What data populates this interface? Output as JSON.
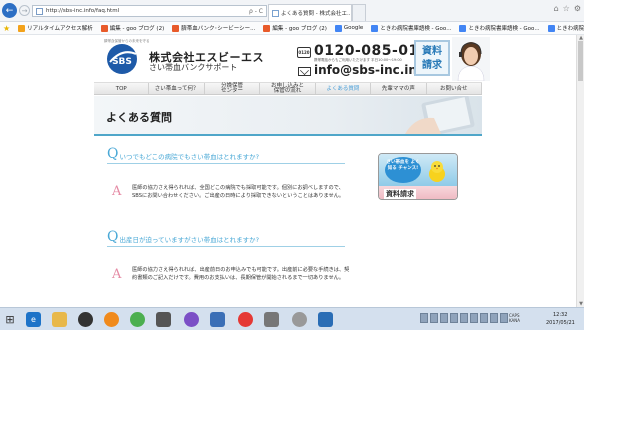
{
  "browser": {
    "url": "http://sbs-inc.info/faq.html",
    "url_tools": "ρ - C",
    "active_tab": "よくある質問 - 株式会社エ...",
    "tab_close": "×",
    "new_tab": "",
    "right_icons": [
      "home-icon",
      "star-icon",
      "gear-icon"
    ]
  },
  "favorites": [
    {
      "label": "リアルタイムアクセス解析",
      "color": "#f3a21b"
    },
    {
      "label": "編集 - goo ブログ (2)",
      "color": "#e85a2a"
    },
    {
      "label": "臍帯血バンク･シービーシー...",
      "color": "#e85a2a"
    },
    {
      "label": "編集 - goo ブログ (2)",
      "color": "#e85a2a"
    },
    {
      "label": "Google",
      "color": "#4285f4"
    },
    {
      "label": "ときわ病院書庫語検 - Goo...",
      "color": "#4285f4"
    },
    {
      "label": "ときわ病院書庫語検 - Goo...",
      "color": "#4285f4"
    },
    {
      "label": "ときわ病院書庫語検 - Goo...",
      "color": "#4285f4"
    }
  ],
  "header": {
    "tagline": "臍帯血保管からの未来を守る",
    "company_name": "株式会社エスビーエス",
    "company_sub": "さい帯血バンクサポート",
    "phone_label": "0120",
    "phone_number": "0120-085-010",
    "hours_note": "携帯電話からもご利用いただけます 平日10:00～19:00",
    "email": "info@sbs-inc.info",
    "cta_line1": "資料",
    "cta_line2": "請求",
    "logo_letters": "SBS"
  },
  "nav": [
    {
      "line1": "TOP",
      "line2": "",
      "active": false
    },
    {
      "line1": "さい帯血って何？",
      "line2": "",
      "active": false
    },
    {
      "line1": "分娩保管",
      "line2": "センター",
      "active": false
    },
    {
      "line1": "お申し込みと",
      "line2": "保管の流れ",
      "active": false
    },
    {
      "line1": "よくある質問",
      "line2": "",
      "active": true
    },
    {
      "line1": "先輩ママの声",
      "line2": "",
      "active": false
    },
    {
      "line1": "お問い合せ",
      "line2": "",
      "active": false
    }
  ],
  "banner": {
    "title": "よくある質問"
  },
  "faq": [
    {
      "q_mark": "Q",
      "question": "いつでもどこの病院でもさい帯血はとれますか?",
      "a_mark": "A",
      "answer": "医師の協力さえ得られれば、全国どこの病院でも採取可能です。個別にお調べしますので、SBSにお問い合わせください。ご出産の日時により採取できないということはありません。"
    },
    {
      "q_mark": "Q",
      "question": "出産日が迫っていますがさい帯血はとれますか?",
      "a_mark": "A",
      "answer": "医師の協力さえ得られれば、出産前日のお申込みでも可能です。出産前に必要な手続きは、契約書類のご記入だけです。費用のお支払いは、長期保管が開始されるまで一切ありません。"
    }
  ],
  "side_cta": {
    "bubble": "さい帯血を よく知る チャンス!",
    "label": "資料請求"
  },
  "taskbar": {
    "tray_text_1": "CAPS",
    "tray_text_2": "KANA",
    "time": "12:32",
    "date": "2017/05/21"
  }
}
